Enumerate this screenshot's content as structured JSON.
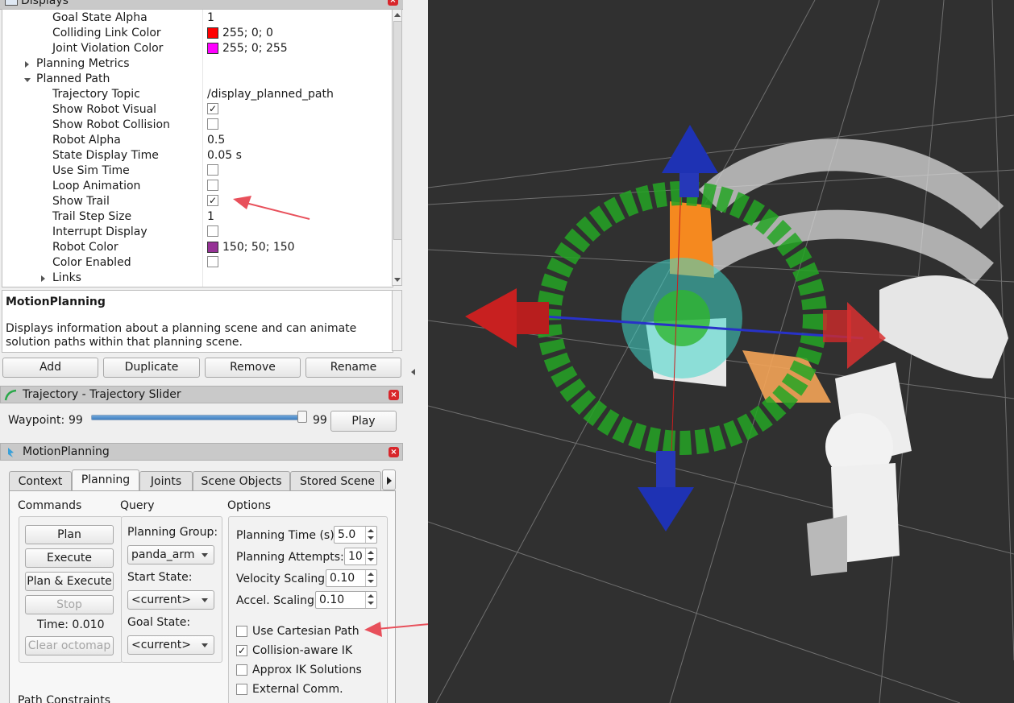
{
  "colors": {
    "accent_blue": "#3f7fc0",
    "annotation_arrow": "#e8505b",
    "viewport_bg": "#303030"
  },
  "displays": {
    "title": "Displays",
    "rows": [
      {
        "label": "Goal State Alpha",
        "value": "1"
      },
      {
        "label": "Colliding Link Color",
        "value": "255; 0; 0",
        "color": "#ff0000"
      },
      {
        "label": "Joint Violation Color",
        "value": "255; 0; 255",
        "color": "#ff00ff"
      },
      {
        "label": "Planning Metrics",
        "value": ""
      },
      {
        "label": "Planned Path",
        "value": ""
      },
      {
        "label": "Trajectory Topic",
        "value": "/display_planned_path"
      },
      {
        "label": "Show Robot Visual",
        "checked": true
      },
      {
        "label": "Show Robot Collision",
        "checked": false
      },
      {
        "label": "Robot Alpha",
        "value": "0.5"
      },
      {
        "label": "State Display Time",
        "value": "0.05 s"
      },
      {
        "label": "Use Sim Time",
        "checked": false
      },
      {
        "label": "Loop Animation",
        "checked": false
      },
      {
        "label": "Show Trail",
        "checked": true
      },
      {
        "label": "Trail Step Size",
        "value": "1"
      },
      {
        "label": "Interrupt Display",
        "checked": false
      },
      {
        "label": "Robot Color",
        "value": "150; 50; 150",
        "color": "#963296"
      },
      {
        "label": "Color Enabled",
        "checked": false
      },
      {
        "label": "Links",
        "value": ""
      }
    ]
  },
  "description": {
    "heading": "MotionPlanning",
    "text": "Displays information about a planning scene and can animate solution paths within that planning scene."
  },
  "display_buttons": {
    "add": "Add",
    "duplicate": "Duplicate",
    "remove": "Remove",
    "rename": "Rename"
  },
  "trajectory": {
    "title": "Trajectory - Trajectory Slider",
    "waypoint_label": "Waypoint:",
    "waypoint_value": "99",
    "waypoint_max": "99",
    "slider_fraction": 1.0,
    "play": "Play"
  },
  "motion_planning": {
    "title": "MotionPlanning",
    "tabs": [
      "Context",
      "Planning",
      "Joints",
      "Scene Objects",
      "Stored Scene"
    ],
    "active_tab": "Planning",
    "commands": {
      "label": "Commands",
      "plan": "Plan",
      "execute": "Execute",
      "plan_execute": "Plan & Execute",
      "stop": "Stop",
      "time": "Time: 0.010",
      "clear_octomap": "Clear octomap"
    },
    "query": {
      "label": "Query",
      "planning_group_label": "Planning Group:",
      "planning_group": "panda_arm",
      "start_state_label": "Start State:",
      "start_state": "<current>",
      "goal_state_label": "Goal State:",
      "goal_state": "<current>"
    },
    "options": {
      "label": "Options",
      "planning_time_label": "Planning Time (s):",
      "planning_time": "5.0",
      "planning_attempts_label": "Planning Attempts:",
      "planning_attempts": "10",
      "velocity_scaling_label": "Velocity Scaling:",
      "velocity_scaling": "0.10",
      "accel_scaling_label": "Accel. Scaling:",
      "accel_scaling": "0.10",
      "use_cartesian_path": "Use Cartesian Path",
      "collision_aware_ik": "Collision-aware IK",
      "approx_ik": "Approx IK Solutions",
      "external_comm": "External Comm."
    },
    "path_constraints": "Path Constraints"
  }
}
